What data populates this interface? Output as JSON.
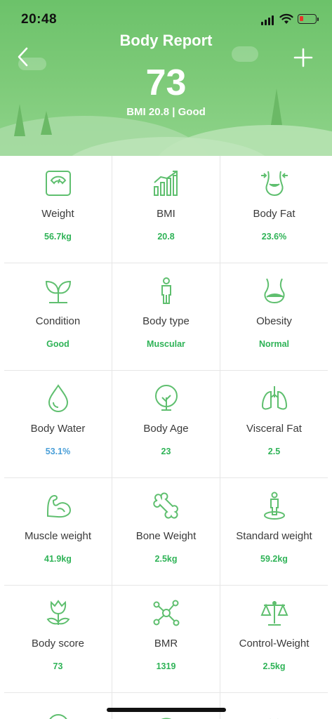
{
  "status_bar": {
    "time": "20:48"
  },
  "header": {
    "title": "Body Report",
    "score": "73",
    "bmi_summary": "BMI 20.8 | Good"
  },
  "colors": {
    "accent_green": "#2fb357",
    "header_green": "#6cc26a",
    "value_blue": "#4a9fd8"
  },
  "metrics": [
    {
      "label": "Weight",
      "value": "56.7kg",
      "icon": "scale-icon"
    },
    {
      "label": "BMI",
      "value": "20.8",
      "icon": "bar-chart-icon"
    },
    {
      "label": "Body Fat",
      "value": "23.6%",
      "icon": "waist-icon"
    },
    {
      "label": "Condition",
      "value": "Good",
      "icon": "sprout-icon"
    },
    {
      "label": "Body type",
      "value": "Muscular",
      "icon": "person-icon"
    },
    {
      "label": "Obesity",
      "value": "Normal",
      "icon": "belly-icon"
    },
    {
      "label": "Body Water",
      "value": "53.1%",
      "icon": "water-drop-icon"
    },
    {
      "label": "Body Age",
      "value": "23",
      "icon": "tree-icon"
    },
    {
      "label": "Visceral Fat",
      "value": "2.5",
      "icon": "lungs-icon"
    },
    {
      "label": "Muscle weight",
      "value": "41.9kg",
      "icon": "flexed-arm-icon"
    },
    {
      "label": "Bone Weight",
      "value": "2.5kg",
      "icon": "bone-icon"
    },
    {
      "label": "Standard weight",
      "value": "59.2kg",
      "icon": "standing-person-icon"
    },
    {
      "label": "Body score",
      "value": "73",
      "icon": "tulip-icon"
    },
    {
      "label": "BMR",
      "value": "1319",
      "icon": "molecule-icon"
    },
    {
      "label": "Control-Weight",
      "value": "2.5kg",
      "icon": "balance-scale-icon"
    }
  ]
}
